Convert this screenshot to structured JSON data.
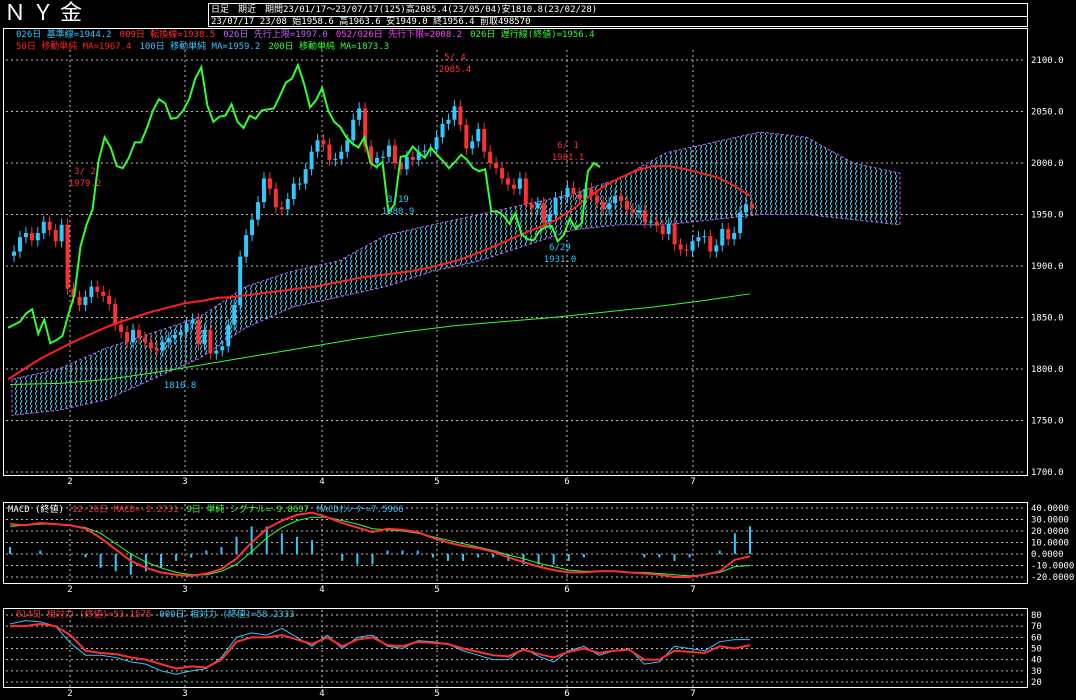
{
  "header": {
    "title": "ＮＹ金",
    "row1": "日足　期近　期間23/01/17～23/07/17(125)高2085.4(23/05/04)安1810.8(23/02/28)",
    "row2": "23/07/17 23/08 始1958.6 高1963.6 安1949.0 終1956.4 前取498570"
  },
  "legend_main": {
    "l1": [
      {
        "text": "026日 基準線=1944.2",
        "color": "#30c8ff"
      },
      {
        "text": "009日 転換線=1938.5",
        "color": "#ff3030"
      },
      {
        "text": "026日 先行上限=1997.0",
        "color": "#c060ff"
      },
      {
        "text": "052/026日 先行下限=2008.2",
        "color": "#ff40ff"
      },
      {
        "text": "026日 遅行線(終値)=1956.4",
        "color": "#30ff30"
      }
    ],
    "l2": [
      {
        "text": "50日 移動単純 MA=1967.4",
        "color": "#ff2020"
      },
      {
        "text": "100日 移動単純 MA=1959.2",
        "color": "#30c8ff"
      },
      {
        "text": "200日 移動単純 MA=1873.3",
        "color": "#30ff30"
      }
    ]
  },
  "legend_macd": [
    {
      "text": "MACD (終値)",
      "color": "#ffffff"
    },
    {
      "text": "12-26日 MACD=-2.2731",
      "color": "#ff3030"
    },
    {
      "text": "9日 単純 シグナル=-9.8697",
      "color": "#30ff30"
    },
    {
      "text": "MACDｵｼﾚｰﾀｰ=7.5966",
      "color": "#30c8ff"
    }
  ],
  "legend_rsi": [
    {
      "text": "014日 相対力 (終値)=53.1575",
      "color": "#ff3030"
    },
    {
      "text": "009日 相対力 (終値)=58.2333",
      "color": "#30c8ff"
    }
  ],
  "annotations": [
    {
      "text": "5/ 4",
      "color": "#ff3030"
    },
    {
      "text": "2085.4",
      "color": "#ff3030"
    },
    {
      "text": "3/ 2",
      "color": "#ff3030"
    },
    {
      "text": "1979.2",
      "color": "#ff3030"
    },
    {
      "text": "6/ 1",
      "color": "#ff3030"
    },
    {
      "text": "1981.1",
      "color": "#ff3030"
    },
    {
      "text": "3/19",
      "color": "#30c8ff"
    },
    {
      "text": "1980.9",
      "color": "#30c8ff"
    },
    {
      "text": "6/29",
      "color": "#30c8ff"
    },
    {
      "text": "1931.0",
      "color": "#30c8ff"
    },
    {
      "text": "1810.8",
      "color": "#30c8ff"
    }
  ],
  "chart_data": [
    {
      "type": "candlestick",
      "x_tick_labels": [
        "2",
        "3",
        "4",
        "5",
        "6",
        "7"
      ],
      "y_tick_labels": [
        "2100.0",
        "2050.0",
        "2000.0",
        "1950.0",
        "1900.0",
        "1850.0",
        "1800.0",
        "1750.0",
        "1700.0"
      ],
      "ylim": [
        1700,
        2100
      ],
      "grid": true,
      "series_colors": {
        "up": "#30c8ff",
        "down": "#ff3030",
        "ma50": "#ff2020",
        "ma100": "#30c8ff",
        "ma200": "#30ff30",
        "lagging": "#30ff30",
        "cloud": "#c060ff"
      },
      "close": [
        1914,
        1928,
        1932,
        1925,
        1932,
        1943,
        1935,
        1924,
        1940,
        1878,
        1870,
        1862,
        1870,
        1880,
        1875,
        1871,
        1863,
        1843,
        1836,
        1826,
        1838,
        1830,
        1826,
        1820,
        1818,
        1826,
        1830,
        1833,
        1836,
        1844,
        1848,
        1824,
        1838,
        1815,
        1818,
        1822,
        1843,
        1862,
        1909,
        1930,
        1945,
        1962,
        1985,
        1975,
        1957,
        1955,
        1965,
        1980,
        1980,
        1994,
        2011,
        2022,
        2018,
        2003,
        2004,
        2011,
        2022,
        2042,
        2053,
        2016,
        2000,
        2005,
        2006,
        2017,
        2000,
        1994,
        2006,
        2003,
        2011,
        2012,
        2013,
        2025,
        2038,
        2042,
        2055,
        2037,
        2014,
        2021,
        2033,
        2011,
        2000,
        1995,
        1985,
        1979,
        1975,
        1985,
        1960,
        1956,
        1961,
        1942,
        1950,
        1966,
        1967,
        1976,
        1970,
        1965,
        1975,
        1968,
        1962,
        1955,
        1961,
        1968,
        1963,
        1955,
        1952,
        1954,
        1943,
        1943,
        1939,
        1931,
        1941,
        1921,
        1916,
        1915,
        1924,
        1928,
        1929,
        1914,
        1920,
        1936,
        1926,
        1932,
        1952,
        1960,
        1956
      ],
      "ma50": [
        1790,
        1800,
        1810,
        1818,
        1826,
        1833,
        1840,
        1846,
        1851,
        1856,
        1860,
        1864,
        1866,
        1869,
        1870,
        1872,
        1874,
        1876,
        1878,
        1880,
        1883,
        1886,
        1889,
        1891,
        1893,
        1895,
        1898,
        1902,
        1906,
        1912,
        1918,
        1925,
        1932,
        1938,
        1945,
        1955,
        1967,
        1978,
        1986,
        1993,
        1997,
        1997,
        1994,
        1990,
        1986,
        1978,
        1968
      ],
      "ma200": [
        1785,
        1786,
        1790,
        1797,
        1805,
        1813,
        1821,
        1829,
        1836,
        1842,
        1846,
        1850,
        1855,
        1860,
        1866,
        1873
      ]
    },
    {
      "type": "line",
      "name": "MACD",
      "y_tick_labels": [
        "40.0000",
        "30.0000",
        "20.0000",
        "10.0000",
        "0.0000",
        "-10.0000",
        "-20.0000"
      ],
      "ylim": [
        -20,
        40
      ],
      "macd": [
        26,
        25,
        27,
        26,
        25,
        22,
        14,
        4,
        -6,
        -12,
        -16,
        -18,
        -19,
        -17,
        -13,
        -4,
        10,
        22,
        29,
        34,
        36,
        32,
        27,
        23,
        19,
        22,
        21,
        19,
        14,
        10,
        7,
        5,
        2,
        -3,
        -7,
        -11,
        -14,
        -16,
        -16,
        -15,
        -15,
        -16,
        -17,
        -18,
        -20,
        -20,
        -18,
        -15,
        -5,
        -2
      ],
      "signal": [
        24,
        25,
        26,
        26,
        25,
        23,
        18,
        9,
        0,
        -7,
        -12,
        -16,
        -18,
        -18,
        -15,
        -9,
        2,
        14,
        23,
        29,
        32,
        32,
        29,
        26,
        22,
        21,
        20,
        18,
        15,
        12,
        9,
        6,
        3,
        -1,
        -4,
        -8,
        -11,
        -14,
        -15,
        -15,
        -15,
        -16,
        -16,
        -17,
        -18,
        -19,
        -18,
        -16,
        -11,
        -10
      ]
    },
    {
      "type": "line",
      "name": "RSI",
      "y_tick_labels": [
        "80",
        "70",
        "60",
        "50",
        "40",
        "30",
        "20"
      ],
      "ylim": [
        20,
        80
      ],
      "rsi14": [
        70,
        70,
        72,
        70,
        62,
        48,
        46,
        45,
        42,
        40,
        36,
        32,
        34,
        33,
        40,
        56,
        60,
        60,
        62,
        58,
        54,
        60,
        52,
        58,
        60,
        53,
        52,
        56,
        55,
        54,
        50,
        47,
        44,
        43,
        49,
        45,
        42,
        47,
        50,
        46,
        48,
        49,
        40,
        40,
        48,
        47,
        46,
        52,
        50,
        53
      ],
      "rsi9": [
        72,
        75,
        74,
        70,
        55,
        44,
        44,
        42,
        38,
        36,
        30,
        27,
        30,
        32,
        42,
        60,
        64,
        62,
        68,
        60,
        52,
        62,
        50,
        60,
        62,
        52,
        50,
        57,
        56,
        54,
        48,
        44,
        40,
        40,
        50,
        43,
        38,
        48,
        52,
        44,
        48,
        50,
        36,
        38,
        52,
        50,
        48,
        56,
        58,
        58
      ]
    }
  ]
}
